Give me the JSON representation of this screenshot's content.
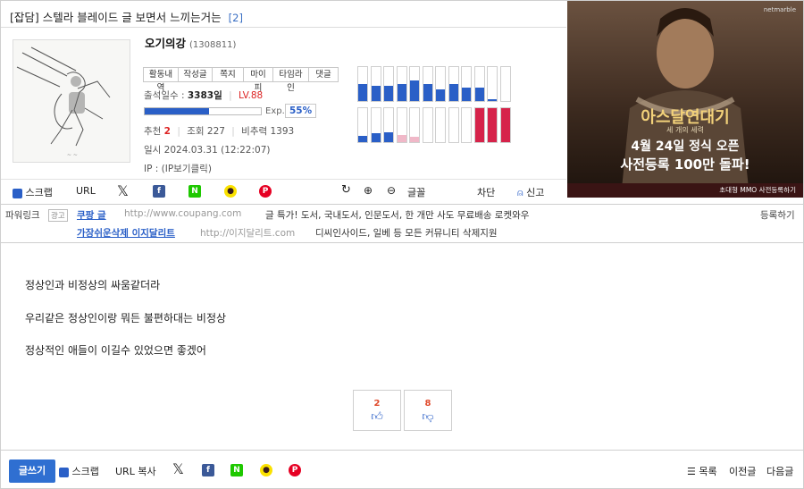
{
  "post": {
    "category": "[잡담]",
    "title": "스텔라 블레이드 글 보면서 느끼는거는",
    "comment_count": "[2]",
    "body": [
      "정상인과 비정상의 싸움같더라",
      "우리같은 정상인이랑 뭐든 불편하대는 비정상",
      "정상적인 애들이 이길수 있었으면 좋겠어"
    ],
    "recommend_label": "추천",
    "recommend": "2",
    "views_label": "조회",
    "views": "227",
    "nonrec_label": "비추력",
    "nonrec": "1393",
    "date_label": "일시",
    "date": "2024.03.31 (12:22:07)",
    "ip_label": "IP :",
    "ip": "(IP보기클릭)"
  },
  "author": {
    "nickname": "오기의강",
    "uid": "(1308811)",
    "tabs": [
      "활동내역",
      "작성글",
      "쪽지",
      "마이피",
      "타임라인",
      "댓글"
    ],
    "attendance_label": "출석일수 :",
    "attendance": "3383일",
    "level": "LV.88",
    "exp_label": "Exp.",
    "exp_pct": "55%",
    "exp_fraction": 0.55
  },
  "activity_chart": {
    "top_row": [
      0.5,
      0.45,
      0.45,
      0.5,
      0.6,
      0.5,
      0.35,
      0.5,
      0.4,
      0.4,
      0.05,
      0
    ],
    "bottom_row": [
      0.18,
      0.25,
      0.3,
      0.2,
      0.15,
      0,
      0,
      0,
      0,
      1,
      1,
      1
    ],
    "top_colors": [
      "#2a5fc7",
      "#2a5fc7",
      "#2a5fc7",
      "#2a5fc7",
      "#2a5fc7",
      "#2a5fc7",
      "#2a5fc7",
      "#2a5fc7",
      "#2a5fc7",
      "#2a5fc7",
      "#2a5fc7",
      "#2a5fc7"
    ],
    "bottom_colors": [
      "#2a5fc7",
      "#2a5fc7",
      "#2a5fc7",
      "#f0b8c8",
      "#f0b8c8",
      "#2a5fc7",
      "#2a5fc7",
      "#2a5fc7",
      "#2a5fc7",
      "#d6234a",
      "#d6234a",
      "#d6234a"
    ]
  },
  "ad": {
    "brand": "netmarble",
    "headline": "아스달연대기",
    "subheadline": "세 개의 세력",
    "line1": "4월 24일 정식 오픈",
    "line2": "사전등록 100만 돌파!",
    "footer": "초대형 MMO 사전등록하기"
  },
  "share_bar": {
    "scrap": "스크랩",
    "url": "URL",
    "font": "글꼴",
    "block": "차단",
    "report": "신고"
  },
  "power_link": {
    "label": "파워링크",
    "ad_badge": "광고",
    "register": "등록하기",
    "items": [
      {
        "name": "쿠팡 글",
        "url": "http://www.coupang.com",
        "desc": "글 특가! 도서, 국내도서, 인문도서, 한 개만 사도 무료배송 로켓와우"
      },
      {
        "name": "가장쉬운삭제 이지달리트",
        "url": "http://이지달리트.com",
        "desc": "디씨인사이드, 일베 등 모든 커뮤니티 삭제지원"
      }
    ]
  },
  "votes": {
    "up": "2",
    "down": "8"
  },
  "footer": {
    "write": "글쓰기",
    "scrap": "스크랩",
    "url_copy": "URL 복사",
    "list": "목록",
    "prev": "이전글",
    "next": "다음글"
  },
  "colors": {
    "accent": "#2f6fd1",
    "level": "#dd2222",
    "link": "#2a5fc7"
  }
}
